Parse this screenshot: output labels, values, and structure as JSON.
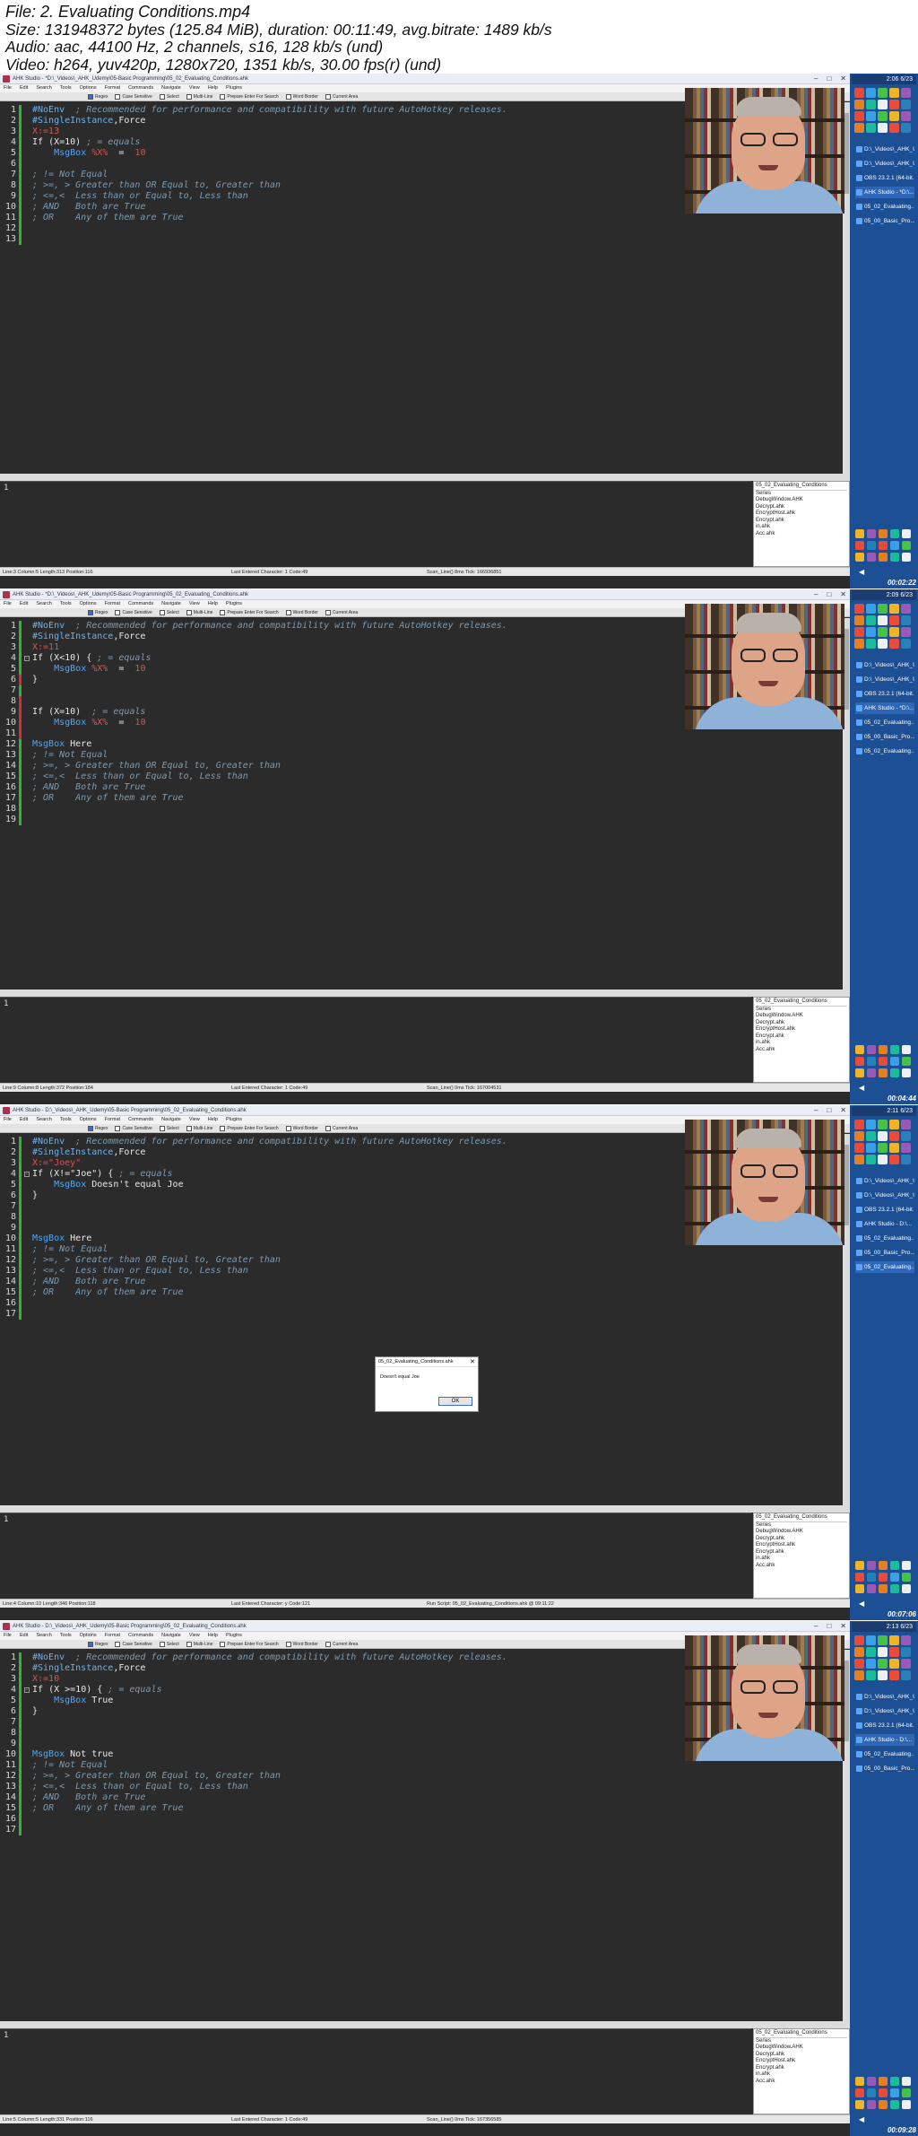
{
  "header": {
    "file_line": "File: 2. Evaluating Conditions.mp4",
    "size_line": "Size: 131948372 bytes (125.84 MiB), duration: 00:11:49, avg.bitrate: 1489 kb/s",
    "audio_line": "Audio: aac, 44100 Hz, 2 channels, s16, 128 kb/s (und)",
    "video_line": "Video: h264, yuv420p, 1280x720, 1351 kb/s, 30.00 fps(r) (und)"
  },
  "app": {
    "menu": [
      "File",
      "Edit",
      "Search",
      "Tools",
      "Options",
      "Format",
      "Commands",
      "Navigate",
      "View",
      "Help",
      "Plugins"
    ],
    "find_options": [
      "Regex",
      "Case Sensitive",
      "Select",
      "Multi-Line",
      "Prepare Enter For Search",
      "Word Border",
      "Current Area"
    ],
    "window_buttons": [
      "–",
      "□",
      "✕"
    ]
  },
  "frames": [
    {
      "title": "AHK Studio - *D:\\_Videos\\_AHK_Udemy\\05-Basic Programming\\05_02_Evaluating_Conditions.ahk",
      "clock": "2:06 6/23",
      "timecode": "00:02:22",
      "code": [
        [
          [
            "dir",
            "#NoEnv"
          ],
          [
            "cm",
            "  ; Recommended for performance and compatibility with future AutoHotkey releases."
          ]
        ],
        [
          [
            "dir",
            "#SingleInstance"
          ],
          [
            "txt",
            ",Force"
          ]
        ],
        [
          [
            "var",
            "X:=13"
          ]
        ],
        [
          [
            "kw",
            "If"
          ],
          [
            "txt",
            " (X=10) "
          ],
          [
            "cm",
            "; = equals"
          ]
        ],
        [
          [
            "txt",
            "    "
          ],
          [
            "cmd",
            "MsgBox"
          ],
          [
            "txt",
            " "
          ],
          [
            "var",
            "%X%"
          ],
          [
            "txt",
            "  =  "
          ],
          [
            "var",
            "10"
          ]
        ],
        [],
        [
          [
            "cm",
            "; != Not Equal"
          ]
        ],
        [
          [
            "cm",
            "; >=, > Greater than OR Equal to, Greater than"
          ]
        ],
        [
          [
            "cm",
            "; <=,<  Less than or Equal to, Less than"
          ]
        ],
        [
          [
            "cm",
            "; AND   Both are True"
          ]
        ],
        [
          [
            "cm",
            "; OR    Any of them are True"
          ]
        ],
        [],
        []
      ],
      "markers": [
        "green",
        "green",
        "green",
        "green",
        "green",
        "green",
        "green",
        "green",
        "green",
        "green",
        "green",
        "green",
        "green"
      ],
      "status": {
        "pos": "Line:3 Column:5 Length:313 Position:116",
        "last": "Last Entered Character: 1 Code:49",
        "scan": "Scan_Line() 8ms Tick: 166936851"
      },
      "output_num": "1",
      "file_title": "05_02_Evaluating_Conditions",
      "files": [
        "Series",
        "DebugWindow.AHK",
        "Decrypt.ahk",
        "EncryptHost.ahk",
        "Encrypt.ahk",
        "in.ahk",
        "Acc.ahk"
      ],
      "taskbar": [
        {
          "label": "D:\\_Videos\\_AHK_Udemy...",
          "active": false
        },
        {
          "label": "D:\\_Videos\\_AHK_Udemy...",
          "active": false
        },
        {
          "label": "OBS 23.2.1 (64-bit...",
          "active": false
        },
        {
          "label": "AHK Studio - *D:\\...",
          "active": true
        },
        {
          "label": "05_02_Evaluating...",
          "active": false
        },
        {
          "label": "05_00_Basic_Pro...",
          "active": false
        }
      ],
      "msgbox": null
    },
    {
      "title": "AHK Studio - *D:\\_Videos\\_AHK_Udemy\\05-Basic Programming\\05_02_Evaluating_Conditions.ahk",
      "clock": "2:09 6/23",
      "timecode": "00:04:44",
      "code": [
        [
          [
            "dir",
            "#NoEnv"
          ],
          [
            "cm",
            "  ; Recommended for performance and compatibility with future AutoHotkey releases."
          ]
        ],
        [
          [
            "dir",
            "#SingleInstance"
          ],
          [
            "txt",
            ",Force"
          ]
        ],
        [
          [
            "var",
            "X:=11"
          ]
        ],
        [
          [
            "kw",
            "If"
          ],
          [
            "txt",
            " (X<10) { "
          ],
          [
            "cm",
            "; = equals"
          ]
        ],
        [
          [
            "txt",
            "    "
          ],
          [
            "cmd",
            "MsgBox"
          ],
          [
            "txt",
            " "
          ],
          [
            "var",
            "%X%"
          ],
          [
            "txt",
            "  =  "
          ],
          [
            "var",
            "10"
          ]
        ],
        [
          [
            "txt",
            "}"
          ]
        ],
        [],
        [],
        [
          [
            "kw",
            "If"
          ],
          [
            "txt",
            " (X=10)  "
          ],
          [
            "cm",
            "; = equals"
          ]
        ],
        [
          [
            "txt",
            "    "
          ],
          [
            "cmd",
            "MsgBox"
          ],
          [
            "txt",
            " "
          ],
          [
            "var",
            "%X%"
          ],
          [
            "txt",
            "  =  "
          ],
          [
            "var",
            "10"
          ]
        ],
        [],
        [
          [
            "cmd",
            "MsgBox"
          ],
          [
            "txt",
            " Here"
          ]
        ],
        [
          [
            "cm",
            "; != Not Equal"
          ]
        ],
        [
          [
            "cm",
            "; >=, > Greater than OR Equal to, Greater than"
          ]
        ],
        [
          [
            "cm",
            "; <=,<  Less than or Equal to, Less than"
          ]
        ],
        [
          [
            "cm",
            "; AND   Both are True"
          ]
        ],
        [
          [
            "cm",
            "; OR    Any of them are True"
          ]
        ],
        [],
        []
      ],
      "markers": [
        "green",
        "green",
        "green",
        "green",
        "green",
        "red",
        "green",
        "red",
        "red",
        "red",
        "red",
        "green",
        "green",
        "green",
        "green",
        "green",
        "green",
        "green",
        "green"
      ],
      "status": {
        "pos": "Line:9 Column:8 Length:372 Position:184",
        "last": "Last Entered Character: 1 Code:49",
        "scan": "Scan_Line() 0ms Tick: 167004531"
      },
      "output_num": "1",
      "file_title": "05_02_Evaluating_Conditions",
      "files": [
        "Series",
        "DebugWindow.AHK",
        "Decrypt.ahk",
        "EncryptHost.ahk",
        "Encrypt.ahk",
        "in.ahk",
        "Acc.ahk"
      ],
      "taskbar": [
        {
          "label": "D:\\_Videos\\_AHK_Udemy...",
          "active": false
        },
        {
          "label": "D:\\_Videos\\_AHK_Udemy...",
          "active": false
        },
        {
          "label": "OBS 23.2.1 (64-bit...",
          "active": false
        },
        {
          "label": "AHK Studio - *D:\\...",
          "active": true
        },
        {
          "label": "05_02_Evaluating...",
          "active": false
        },
        {
          "label": "05_00_Basic_Pro...",
          "active": false
        },
        {
          "label": "05_02_Evaluating...",
          "active": false
        }
      ],
      "msgbox": null
    },
    {
      "title": "AHK Studio - D:\\_Videos\\_AHK_Udemy\\05-Basic Programming\\05_02_Evaluating_Conditions.ahk",
      "clock": "2:11 6/23",
      "timecode": "00:07:06",
      "code": [
        [
          [
            "dir",
            "#NoEnv"
          ],
          [
            "cm",
            "  ; Recommended for performance and compatibility with future AutoHotkey releases."
          ]
        ],
        [
          [
            "dir",
            "#SingleInstance"
          ],
          [
            "txt",
            ",Force"
          ]
        ],
        [
          [
            "var",
            "X:=\"Joey\""
          ]
        ],
        [
          [
            "kw",
            "If"
          ],
          [
            "txt",
            " (X!=\"Joe\") { "
          ],
          [
            "cm",
            "; = equals"
          ]
        ],
        [
          [
            "txt",
            "    "
          ],
          [
            "cmd",
            "MsgBox"
          ],
          [
            "txt",
            " Doesn't equal Joe"
          ]
        ],
        [
          [
            "txt",
            "}"
          ]
        ],
        [],
        [],
        [],
        [
          [
            "cmd",
            "MsgBox"
          ],
          [
            "txt",
            " Here"
          ]
        ],
        [
          [
            "cm",
            "; != Not Equal"
          ]
        ],
        [
          [
            "cm",
            "; >=, > Greater than OR Equal to, Greater than"
          ]
        ],
        [
          [
            "cm",
            "; <=,<  Less than or Equal to, Less than"
          ]
        ],
        [
          [
            "cm",
            "; AND   Both are True"
          ]
        ],
        [
          [
            "cm",
            "; OR    Any of them are True"
          ]
        ],
        [],
        []
      ],
      "markers": [
        "green",
        "green",
        "green",
        "green",
        "green",
        "green",
        "green",
        "green",
        "green",
        "green",
        "green",
        "green",
        "green",
        "green",
        "green",
        "green",
        "green"
      ],
      "status": {
        "pos": "Line:4 Column:10 Length:346 Position:118",
        "last": "Last Entered Character: y Code:121",
        "scan": "Run Script: 05_02_Evaluating_Conditions.ahk @ 09:11:22"
      },
      "output_num": "1",
      "file_title": "05_02_Evaluating_Conditions",
      "files": [
        "Series",
        "DebugWindow.AHK",
        "Decrypt.ahk",
        "EncryptHost.ahk",
        "Encrypt.ahk",
        "in.ahk",
        "Acc.ahk"
      ],
      "taskbar": [
        {
          "label": "D:\\_Videos\\_AHK_Udemy...",
          "active": false
        },
        {
          "label": "D:\\_Videos\\_AHK_Udemy...",
          "active": false
        },
        {
          "label": "OBS 23.2.1 (64-bit...",
          "active": false
        },
        {
          "label": "AHK Studio - D:\\...",
          "active": false
        },
        {
          "label": "05_02_Evaluating...",
          "active": false
        },
        {
          "label": "05_00_Basic_Pro...",
          "active": false
        },
        {
          "label": "05_02_Evaluating...",
          "active": true
        }
      ],
      "msgbox": {
        "title": "05_02_Evaluating_Conditions.ahk",
        "text": "Doesn't equal Joe",
        "ok": "OK"
      }
    },
    {
      "title": "AHK Studio - D:\\_Videos\\_AHK_Udemy\\05-Basic Programming\\05_02_Evaluating_Conditions.ahk",
      "clock": "2:13 6/23",
      "timecode": "00:09:28",
      "code": [
        [
          [
            "dir",
            "#NoEnv"
          ],
          [
            "cm",
            "  ; Recommended for performance and compatibility with future AutoHotkey releases."
          ]
        ],
        [
          [
            "dir",
            "#SingleInstance"
          ],
          [
            "txt",
            ",Force"
          ]
        ],
        [
          [
            "var",
            "X:=10"
          ]
        ],
        [
          [
            "kw",
            "If"
          ],
          [
            "txt",
            " (X >=10) { "
          ],
          [
            "cm",
            "; = equals"
          ]
        ],
        [
          [
            "txt",
            "    "
          ],
          [
            "cmd",
            "MsgBox"
          ],
          [
            "txt",
            " True"
          ]
        ],
        [
          [
            "txt",
            "}"
          ]
        ],
        [],
        [],
        [],
        [
          [
            "cmd",
            "MsgBox"
          ],
          [
            "txt",
            " Not true"
          ]
        ],
        [
          [
            "cm",
            "; != Not Equal"
          ]
        ],
        [
          [
            "cm",
            "; >=, > Greater than OR Equal to, Greater than"
          ]
        ],
        [
          [
            "cm",
            "; <=,<  Less than or Equal to, Less than"
          ]
        ],
        [
          [
            "cm",
            "; AND   Both are True"
          ]
        ],
        [
          [
            "cm",
            "; OR    Any of them are True"
          ]
        ],
        [],
        []
      ],
      "markers": [
        "green",
        "green",
        "green",
        "green",
        "green",
        "green",
        "green",
        "green",
        "green",
        "green",
        "green",
        "green",
        "green",
        "green",
        "green",
        "green",
        "green"
      ],
      "status": {
        "pos": "Line:5 Column:5 Length:331 Position:116",
        "last": "Last Entered Character: 1 Code:49",
        "scan": "Scan_Line() 0ms Tick: 167356585"
      },
      "output_num": "1",
      "file_title": "05_02_Evaluating_Conditions",
      "files": [
        "Series",
        "DebugWindow.AHK",
        "Decrypt.ahk",
        "EncryptHost.ahk",
        "Encrypt.ahk",
        "in.ahk",
        "Acc.ahk"
      ],
      "taskbar": [
        {
          "label": "D:\\_Videos\\_AHK_Udemy...",
          "active": false
        },
        {
          "label": "D:\\_Videos\\_AHK_Udemy...",
          "active": false
        },
        {
          "label": "OBS 23.2.1 (64-bit...",
          "active": false
        },
        {
          "label": "AHK Studio - D:\\...",
          "active": true
        },
        {
          "label": "05_02_Evaluating...",
          "active": false
        },
        {
          "label": "05_00_Basic_Pro...",
          "active": false
        }
      ],
      "msgbox": null
    }
  ],
  "colors": {
    "editor_bg": "#2b2b2b",
    "taskbar_bg": "#1c4f94",
    "marker_green": "#2fb52f",
    "marker_red": "#d03030",
    "comment": "#7a9bb3",
    "directive": "#6fb0e8",
    "variable": "#d9534f",
    "command": "#4aa8ff"
  }
}
